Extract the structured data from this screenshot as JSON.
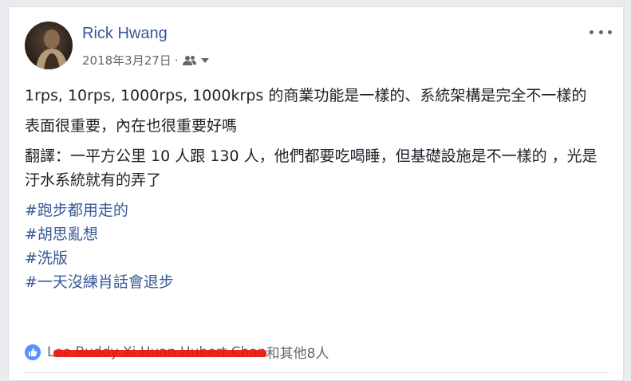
{
  "post": {
    "author": "Rick Hwang",
    "date": "2018年3月27日",
    "separator": "·",
    "audience_icon": "friends-icon",
    "paragraphs": [
      "1rps, 10rps, 1000rps, 1000krps 的商業功能是一樣的、系統架構是完全不一樣的",
      "表面很重要，內在也很重要好嗎",
      "翻譯：一平方公里 10 人跟 130 人，他們都要吃喝睡，但基礎設施是不一樣的 ，光是汙水系統就有的弄了"
    ],
    "hashtags": [
      "#跑步都用走的",
      "#胡思亂想",
      "#洗版",
      "#一天沒練肖話會退步"
    ],
    "reactions": {
      "names": "Lee Buddy Xi Huan Hubert Chan",
      "others": "和其他8人"
    }
  },
  "colors": {
    "link": "#365899",
    "hashtag": "#385898",
    "text": "#1d2129",
    "meta": "#616770",
    "like": "#5890ff",
    "redaction": "#e8160c"
  }
}
